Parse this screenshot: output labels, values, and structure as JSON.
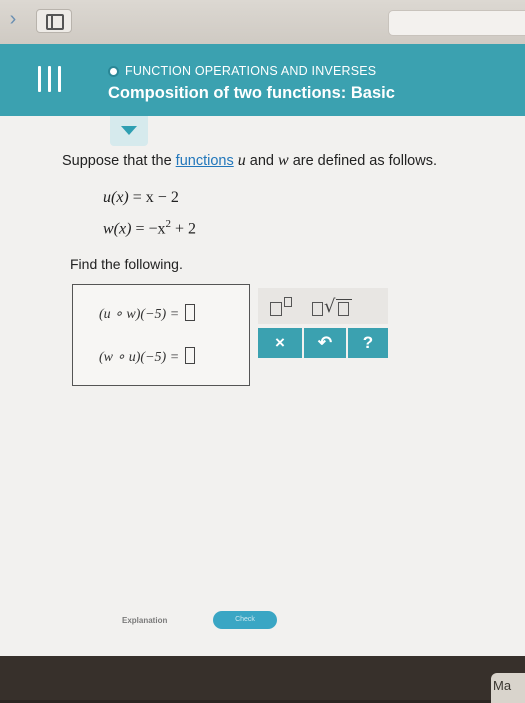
{
  "browser": {
    "back_icon": "chevron-right-icon",
    "sidebar_icon": "sidebar-icon"
  },
  "header": {
    "topic": "FUNCTION OPERATIONS AND INVERSES",
    "title": "Composition of two functions: Basic",
    "menu_icon": "hamburger-icon",
    "accent_color": "#3ba1b0"
  },
  "problem": {
    "text_before": "Suppose that the ",
    "link_text": "functions",
    "text_mid1": " ",
    "var_u": "u",
    "text_mid2": " and ",
    "var_w": "w",
    "text_after": " are defined as follows.",
    "eq1": {
      "lhs": "u(x)",
      "rhs": "= x − 2"
    },
    "eq2": {
      "lhs": "w(x)",
      "rhs": "= −x",
      "exp": "2",
      "tail": " + 2"
    },
    "find": "Find the following."
  },
  "answers": {
    "row1": {
      "expr": "(u ∘ w)(−5) ="
    },
    "row2": {
      "expr": "(w ∘ u)(−5) ="
    }
  },
  "tools": {
    "clear": "×",
    "undo": "↶",
    "help": "?"
  },
  "actions": {
    "explanation": "Explanation",
    "check": "Check"
  },
  "device": {
    "brand_partial": "Ma"
  }
}
